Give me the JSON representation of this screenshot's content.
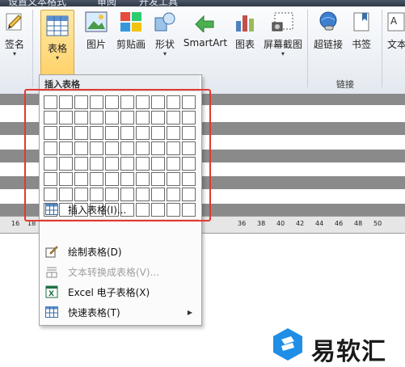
{
  "tabs": [
    "设置文本格式",
    "审阅",
    "开发工具"
  ],
  "ribbon": {
    "buttons": [
      {
        "key": "signature",
        "label": "签名"
      },
      {
        "key": "table",
        "label": "表格"
      },
      {
        "key": "picture",
        "label": "图片"
      },
      {
        "key": "clipart",
        "label": "剪贴画"
      },
      {
        "key": "shapes",
        "label": "形状"
      },
      {
        "key": "smartart",
        "label": "SmartArt"
      },
      {
        "key": "chart",
        "label": "图表"
      },
      {
        "key": "screenshot",
        "label": "屏幕截图"
      },
      {
        "key": "hyperlink",
        "label": "超链接"
      },
      {
        "key": "bookmark",
        "label": "书签"
      },
      {
        "key": "text",
        "label": "文本"
      }
    ],
    "group_link_label": "链接"
  },
  "dropdown": {
    "title": "插入表格",
    "grid_columns": 10,
    "grid_rows": 8,
    "items": [
      {
        "label": "插入表格(I)...",
        "icon": "insert-table-icon",
        "enabled": true,
        "submenu": false
      },
      {
        "label": "绘制表格(D)",
        "icon": "draw-table-icon",
        "enabled": true,
        "submenu": false
      },
      {
        "label": "文本转换成表格(V)...",
        "icon": "text-to-table-icon",
        "enabled": false,
        "submenu": false
      },
      {
        "label": "Excel 电子表格(X)",
        "icon": "excel-icon",
        "enabled": true,
        "submenu": false
      },
      {
        "label": "快速表格(T)",
        "icon": "quick-table-icon",
        "enabled": true,
        "submenu": true
      }
    ]
  },
  "ruler": {
    "numbers": [
      "16",
      "18",
      "36",
      "38",
      "40",
      "42",
      "44",
      "46",
      "48",
      "50"
    ]
  },
  "watermark": {
    "text": "易软汇"
  },
  "colors": {
    "highlight": "#e23a2e",
    "ribbon_hover": "#ffd26a",
    "watermark_blue": "#1f8ee6"
  }
}
